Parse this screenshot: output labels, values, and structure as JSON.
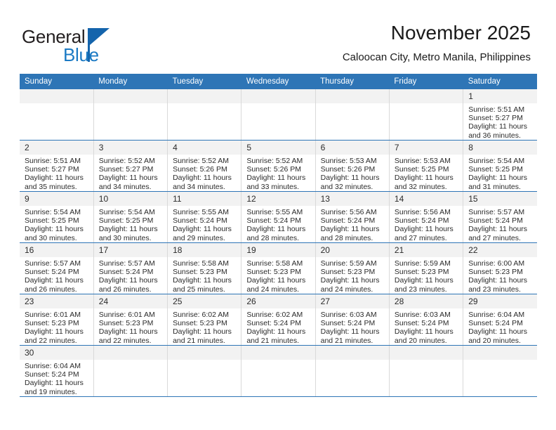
{
  "brand": {
    "name_part1": "General",
    "name_part2": "Blue",
    "accent_color": "#1464ac",
    "blue_text_color": "#1b7ac4"
  },
  "header": {
    "title": "November 2025",
    "subtitle": "Caloocan City, Metro Manila, Philippines"
  },
  "theme": {
    "header_blue": "#2e75b6",
    "daynum_band": "#f2f2f2",
    "cell_border": "#d9d9d9"
  },
  "weekdays": [
    "Sunday",
    "Monday",
    "Tuesday",
    "Wednesday",
    "Thursday",
    "Friday",
    "Saturday"
  ],
  "labels": {
    "sunrise_prefix": "Sunrise: ",
    "sunset_prefix": "Sunset: ",
    "daylight_prefix": "Daylight: "
  },
  "weeks": [
    [
      {
        "empty": true
      },
      {
        "empty": true
      },
      {
        "empty": true
      },
      {
        "empty": true
      },
      {
        "empty": true
      },
      {
        "empty": true
      },
      {
        "day": "1",
        "sunrise": "Sunrise: 5:51 AM",
        "sunset": "Sunset: 5:27 PM",
        "daylight_line1": "Daylight: 11 hours",
        "daylight_line2": "and 36 minutes."
      }
    ],
    [
      {
        "day": "2",
        "sunrise": "Sunrise: 5:51 AM",
        "sunset": "Sunset: 5:27 PM",
        "daylight_line1": "Daylight: 11 hours",
        "daylight_line2": "and 35 minutes."
      },
      {
        "day": "3",
        "sunrise": "Sunrise: 5:52 AM",
        "sunset": "Sunset: 5:27 PM",
        "daylight_line1": "Daylight: 11 hours",
        "daylight_line2": "and 34 minutes."
      },
      {
        "day": "4",
        "sunrise": "Sunrise: 5:52 AM",
        "sunset": "Sunset: 5:26 PM",
        "daylight_line1": "Daylight: 11 hours",
        "daylight_line2": "and 34 minutes."
      },
      {
        "day": "5",
        "sunrise": "Sunrise: 5:52 AM",
        "sunset": "Sunset: 5:26 PM",
        "daylight_line1": "Daylight: 11 hours",
        "daylight_line2": "and 33 minutes."
      },
      {
        "day": "6",
        "sunrise": "Sunrise: 5:53 AM",
        "sunset": "Sunset: 5:26 PM",
        "daylight_line1": "Daylight: 11 hours",
        "daylight_line2": "and 32 minutes."
      },
      {
        "day": "7",
        "sunrise": "Sunrise: 5:53 AM",
        "sunset": "Sunset: 5:25 PM",
        "daylight_line1": "Daylight: 11 hours",
        "daylight_line2": "and 32 minutes."
      },
      {
        "day": "8",
        "sunrise": "Sunrise: 5:54 AM",
        "sunset": "Sunset: 5:25 PM",
        "daylight_line1": "Daylight: 11 hours",
        "daylight_line2": "and 31 minutes."
      }
    ],
    [
      {
        "day": "9",
        "sunrise": "Sunrise: 5:54 AM",
        "sunset": "Sunset: 5:25 PM",
        "daylight_line1": "Daylight: 11 hours",
        "daylight_line2": "and 30 minutes."
      },
      {
        "day": "10",
        "sunrise": "Sunrise: 5:54 AM",
        "sunset": "Sunset: 5:25 PM",
        "daylight_line1": "Daylight: 11 hours",
        "daylight_line2": "and 30 minutes."
      },
      {
        "day": "11",
        "sunrise": "Sunrise: 5:55 AM",
        "sunset": "Sunset: 5:24 PM",
        "daylight_line1": "Daylight: 11 hours",
        "daylight_line2": "and 29 minutes."
      },
      {
        "day": "12",
        "sunrise": "Sunrise: 5:55 AM",
        "sunset": "Sunset: 5:24 PM",
        "daylight_line1": "Daylight: 11 hours",
        "daylight_line2": "and 28 minutes."
      },
      {
        "day": "13",
        "sunrise": "Sunrise: 5:56 AM",
        "sunset": "Sunset: 5:24 PM",
        "daylight_line1": "Daylight: 11 hours",
        "daylight_line2": "and 28 minutes."
      },
      {
        "day": "14",
        "sunrise": "Sunrise: 5:56 AM",
        "sunset": "Sunset: 5:24 PM",
        "daylight_line1": "Daylight: 11 hours",
        "daylight_line2": "and 27 minutes."
      },
      {
        "day": "15",
        "sunrise": "Sunrise: 5:57 AM",
        "sunset": "Sunset: 5:24 PM",
        "daylight_line1": "Daylight: 11 hours",
        "daylight_line2": "and 27 minutes."
      }
    ],
    [
      {
        "day": "16",
        "sunrise": "Sunrise: 5:57 AM",
        "sunset": "Sunset: 5:24 PM",
        "daylight_line1": "Daylight: 11 hours",
        "daylight_line2": "and 26 minutes."
      },
      {
        "day": "17",
        "sunrise": "Sunrise: 5:57 AM",
        "sunset": "Sunset: 5:24 PM",
        "daylight_line1": "Daylight: 11 hours",
        "daylight_line2": "and 26 minutes."
      },
      {
        "day": "18",
        "sunrise": "Sunrise: 5:58 AM",
        "sunset": "Sunset: 5:23 PM",
        "daylight_line1": "Daylight: 11 hours",
        "daylight_line2": "and 25 minutes."
      },
      {
        "day": "19",
        "sunrise": "Sunrise: 5:58 AM",
        "sunset": "Sunset: 5:23 PM",
        "daylight_line1": "Daylight: 11 hours",
        "daylight_line2": "and 24 minutes."
      },
      {
        "day": "20",
        "sunrise": "Sunrise: 5:59 AM",
        "sunset": "Sunset: 5:23 PM",
        "daylight_line1": "Daylight: 11 hours",
        "daylight_line2": "and 24 minutes."
      },
      {
        "day": "21",
        "sunrise": "Sunrise: 5:59 AM",
        "sunset": "Sunset: 5:23 PM",
        "daylight_line1": "Daylight: 11 hours",
        "daylight_line2": "and 23 minutes."
      },
      {
        "day": "22",
        "sunrise": "Sunrise: 6:00 AM",
        "sunset": "Sunset: 5:23 PM",
        "daylight_line1": "Daylight: 11 hours",
        "daylight_line2": "and 23 minutes."
      }
    ],
    [
      {
        "day": "23",
        "sunrise": "Sunrise: 6:01 AM",
        "sunset": "Sunset: 5:23 PM",
        "daylight_line1": "Daylight: 11 hours",
        "daylight_line2": "and 22 minutes."
      },
      {
        "day": "24",
        "sunrise": "Sunrise: 6:01 AM",
        "sunset": "Sunset: 5:23 PM",
        "daylight_line1": "Daylight: 11 hours",
        "daylight_line2": "and 22 minutes."
      },
      {
        "day": "25",
        "sunrise": "Sunrise: 6:02 AM",
        "sunset": "Sunset: 5:23 PM",
        "daylight_line1": "Daylight: 11 hours",
        "daylight_line2": "and 21 minutes."
      },
      {
        "day": "26",
        "sunrise": "Sunrise: 6:02 AM",
        "sunset": "Sunset: 5:24 PM",
        "daylight_line1": "Daylight: 11 hours",
        "daylight_line2": "and 21 minutes."
      },
      {
        "day": "27",
        "sunrise": "Sunrise: 6:03 AM",
        "sunset": "Sunset: 5:24 PM",
        "daylight_line1": "Daylight: 11 hours",
        "daylight_line2": "and 21 minutes."
      },
      {
        "day": "28",
        "sunrise": "Sunrise: 6:03 AM",
        "sunset": "Sunset: 5:24 PM",
        "daylight_line1": "Daylight: 11 hours",
        "daylight_line2": "and 20 minutes."
      },
      {
        "day": "29",
        "sunrise": "Sunrise: 6:04 AM",
        "sunset": "Sunset: 5:24 PM",
        "daylight_line1": "Daylight: 11 hours",
        "daylight_line2": "and 20 minutes."
      }
    ],
    [
      {
        "day": "30",
        "sunrise": "Sunrise: 6:04 AM",
        "sunset": "Sunset: 5:24 PM",
        "daylight_line1": "Daylight: 11 hours",
        "daylight_line2": "and 19 minutes."
      },
      {
        "empty": true
      },
      {
        "empty": true
      },
      {
        "empty": true
      },
      {
        "empty": true
      },
      {
        "empty": true
      },
      {
        "empty": true
      }
    ]
  ]
}
